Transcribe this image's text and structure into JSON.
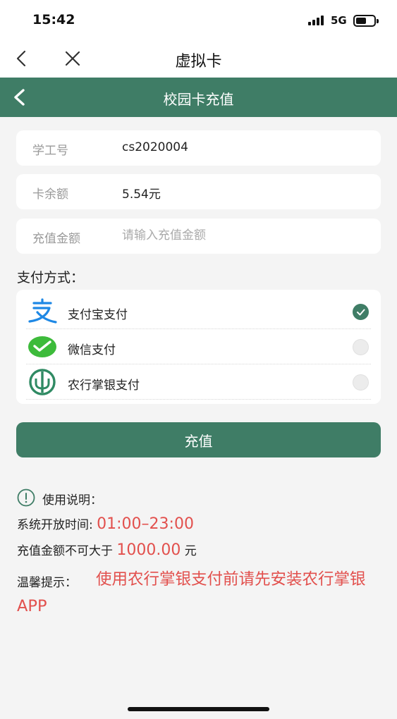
{
  "status_bar": {
    "time": "15:42",
    "network": "5G"
  },
  "nav": {
    "title": "虚拟卡"
  },
  "header": {
    "title": "校园卡充值"
  },
  "form": {
    "student_id_label": "学工号",
    "student_id_value": "cs2020004",
    "balance_label": "卡余额",
    "balance_value": "5.54元",
    "amount_label": "充值金额",
    "amount_placeholder": "请输入充值金额"
  },
  "payment": {
    "heading": "支付方式：",
    "options": [
      {
        "label": "支付宝支付",
        "icon": "alipay-icon",
        "selected": true
      },
      {
        "label": "微信支付",
        "icon": "wechat-pay-icon",
        "selected": false
      },
      {
        "label": "农行掌银支付",
        "icon": "abc-bank-icon",
        "selected": false
      }
    ]
  },
  "submit_label": "充值",
  "instructions": {
    "title": "使用说明：",
    "hours_label": "系统开放时间: ",
    "hours_value": "01:00–23:00",
    "limit_label": "充值金额不可大于 ",
    "limit_value": "1000.00",
    "limit_unit": " 元",
    "tip_label": "温馨提示：",
    "tip_text": "使用农行掌银支付前请先安装农行掌银APP"
  },
  "colors": {
    "brand_green": "#3f7d66",
    "warning_red": "#e2504d"
  }
}
